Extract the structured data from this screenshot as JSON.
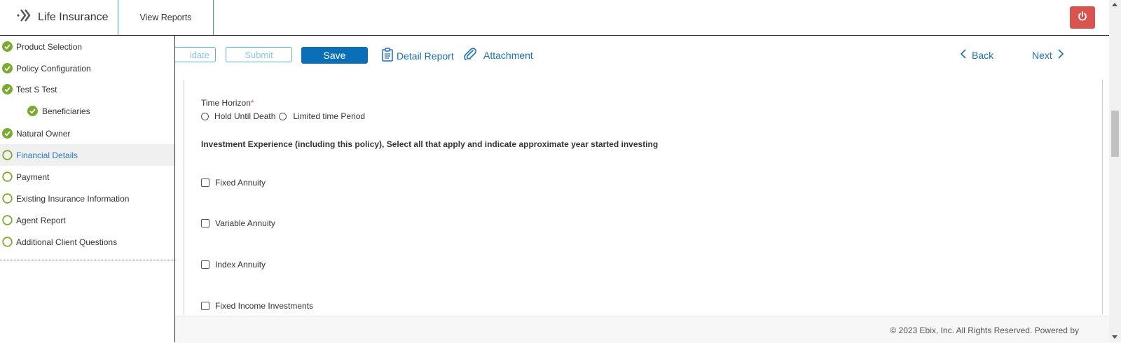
{
  "app": {
    "title": "Life Insurance",
    "tab_view_reports": "View Reports"
  },
  "sidebar": {
    "items": [
      {
        "label": "Product Selection",
        "status": "complete"
      },
      {
        "label": "Policy Configuration",
        "status": "complete"
      },
      {
        "label": "Test S Test",
        "status": "complete"
      },
      {
        "label": "Beneficiaries",
        "status": "complete"
      },
      {
        "label": "Natural Owner",
        "status": "complete"
      },
      {
        "label": "Financial Details",
        "status": "active"
      },
      {
        "label": "Payment",
        "status": "incomplete"
      },
      {
        "label": "Existing Insurance Information",
        "status": "incomplete"
      },
      {
        "label": "Agent Report",
        "status": "incomplete"
      },
      {
        "label": "Additional Client Questions",
        "status": "incomplete"
      }
    ]
  },
  "toolbar": {
    "validate_label": "idate",
    "submit_label": "Submit",
    "save_label": "Save",
    "detail_report_label": "Detail Report",
    "attachment_label": "Attachment",
    "back_label": "Back",
    "next_label": "Next"
  },
  "form": {
    "time_horizon_label": "Time Horizon",
    "required_mark": "*",
    "time_horizon_options": [
      "Hold Until Death",
      "Limited time Period"
    ],
    "investment_experience_title": "Investment Experience (including this policy), Select all that apply and indicate approximate year started investing",
    "investment_options": [
      "Fixed Annuity",
      "Variable Annuity",
      "Index Annuity",
      "Fixed Income Investments"
    ]
  },
  "footer": {
    "copyright": "© 2023 Ebix, Inc. All Rights Reserved. Powered by"
  },
  "colors": {
    "accent": "#0a6fb7",
    "complete_green": "#7aab2e",
    "power_red": "#d9534f",
    "link_blue": "#1a6fb5"
  }
}
